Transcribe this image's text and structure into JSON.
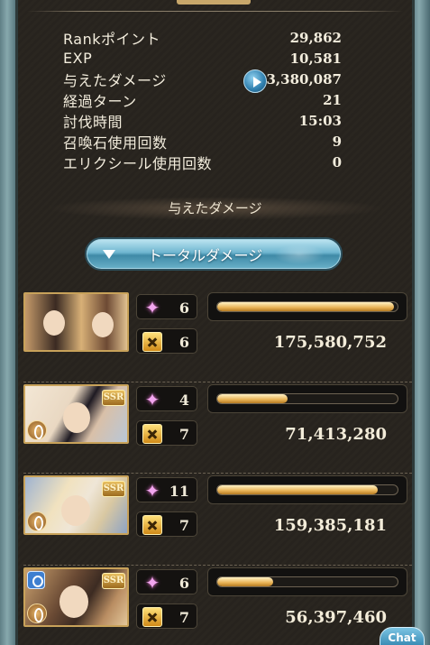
{
  "stats": {
    "rows": [
      {
        "label": "Rankポイント",
        "value": "29,862"
      },
      {
        "label": "EXP",
        "value": "10,581"
      },
      {
        "label": "与えたダメージ",
        "value": "603,380,087"
      },
      {
        "label": "経過ターン",
        "value": "21"
      },
      {
        "label": "討伐時間",
        "value": "15:03"
      },
      {
        "label": "召喚石使用回数",
        "value": "9"
      },
      {
        "label": "エリクシール使用回数",
        "value": "0"
      }
    ]
  },
  "damage_section": {
    "title": "与えたダメージ",
    "dropdown_label": "トータルダメージ"
  },
  "characters": [
    {
      "skills": "6",
      "ougi": "6",
      "damage": "175,580,752",
      "bar_fraction": 0.98,
      "ssr": "",
      "element_icon": "",
      "portrait": "duo-masked-characters"
    },
    {
      "skills": "4",
      "ougi": "7",
      "damage": "71,413,280",
      "bar_fraction": 0.39,
      "ssr": "SSR",
      "element_icon": "dark-element-icon",
      "portrait": "dark-haired-girl"
    },
    {
      "skills": "11",
      "ougi": "7",
      "damage": "159,385,181",
      "bar_fraction": 0.89,
      "ssr": "SSR",
      "element_icon": "dark-element-icon",
      "portrait": "blonde-girl"
    },
    {
      "skills": "6",
      "ougi": "7",
      "damage": "56,397,460",
      "bar_fraction": 0.31,
      "ssr": "SSR",
      "element_icon": "dark-element-icon",
      "portrait": "brown-haired-girl"
    }
  ],
  "chat": {
    "label": "Chat"
  },
  "colors": {
    "bar_fill": "#e8b255",
    "frame": "#87a8ad",
    "button_blue": "#6fb6d0"
  }
}
